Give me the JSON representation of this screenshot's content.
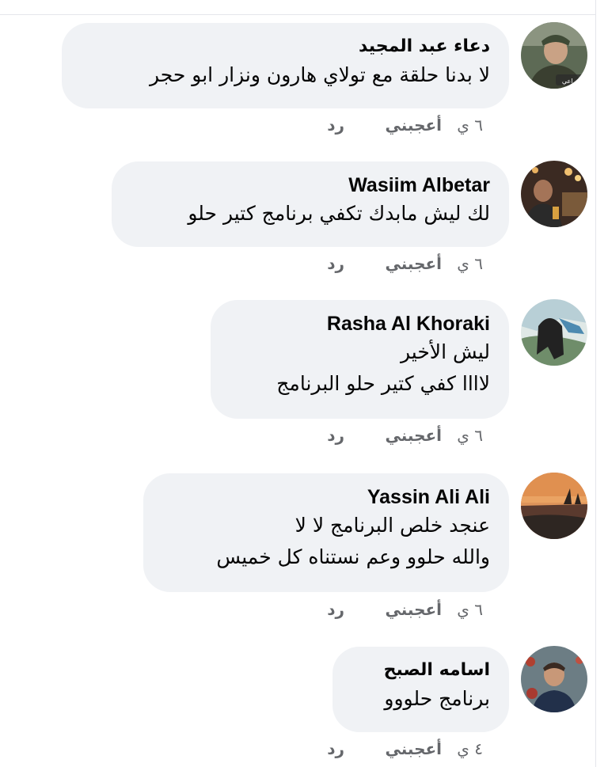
{
  "comments": [
    {
      "author": "دعاء عبد المجيد",
      "lines": [
        "لا بدنا حلقة مع تولاي هارون ونزار ابو حجر"
      ],
      "time": "٦ ي",
      "like_label": "أعجبني",
      "reply_label": "رد",
      "avatar_label": "يراعي"
    },
    {
      "author": "Wasiim Albetar",
      "lines": [
        "لك ليش مابدك تكفي برنامج كتير حلو"
      ],
      "time": "٦ ي",
      "like_label": "أعجبني",
      "reply_label": "رد"
    },
    {
      "author": "Rasha Al Khoraki",
      "lines": [
        "ليش الأخير",
        "لاااا كفي كتير حلو البرنامج"
      ],
      "time": "٦ ي",
      "like_label": "أعجبني",
      "reply_label": "رد"
    },
    {
      "author": "Yassin Ali Ali",
      "lines": [
        "عنجد خلص البرنامج لا لا",
        "والله حلوو وعم نستناه كل خميس"
      ],
      "time": "٦ ي",
      "like_label": "أعجبني",
      "reply_label": "رد"
    },
    {
      "author": "اسامه الصبح",
      "lines": [
        "برنامج حلووو"
      ],
      "time": "٤ ي",
      "like_label": "أعجبني",
      "reply_label": "رد"
    }
  ],
  "colors": {
    "bubble": "#f0f2f5",
    "text": "#050505",
    "meta": "#65676b"
  }
}
